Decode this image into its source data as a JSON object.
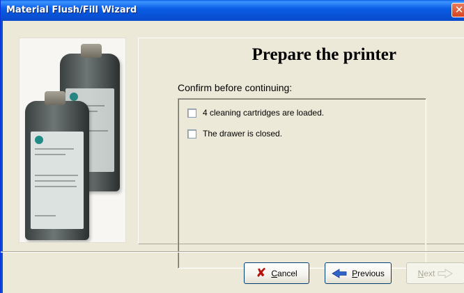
{
  "window": {
    "title": "Material Flush/Fill Wizard",
    "close_glyph": "✕"
  },
  "page": {
    "heading": "Prepare the printer",
    "confirm_label": "Confirm before continuing:",
    "items": [
      {
        "label": "4 cleaning cartridges are loaded.",
        "checked": false
      },
      {
        "label": "The drawer is closed.",
        "checked": false
      }
    ]
  },
  "buttons": {
    "cancel": {
      "mnemonic": "C",
      "rest": "ancel",
      "icon": "x-icon",
      "enabled": true
    },
    "previous": {
      "mnemonic": "P",
      "rest": "revious",
      "icon": "arrow-left-icon",
      "enabled": true
    },
    "next": {
      "mnemonic": "N",
      "rest": "ext",
      "icon": "arrow-right-icon",
      "enabled": false
    }
  },
  "colors": {
    "titlebar": "#0A5EE8",
    "dialog_bg": "#ECE9D8",
    "cancel_icon": "#B5120C",
    "previous_arrow": "#2F64C8"
  }
}
